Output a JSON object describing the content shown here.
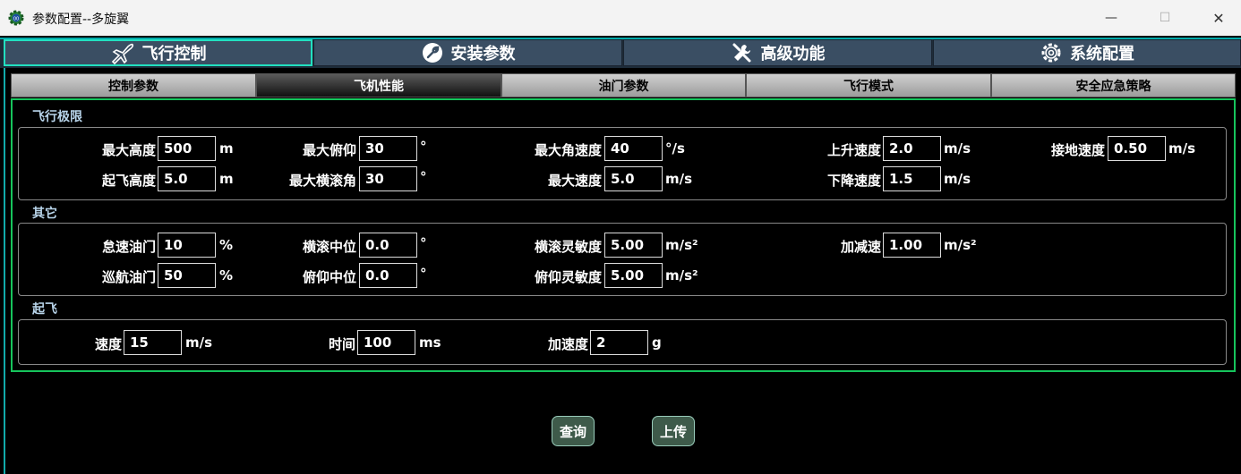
{
  "window": {
    "title": "参数配置--多旋翼",
    "minimize": "—",
    "maximize": "☐",
    "close": "✕"
  },
  "main_tabs": [
    {
      "label": "飞行控制",
      "icon": "airplane-icon",
      "active": true
    },
    {
      "label": "安装参数",
      "icon": "wrench-icon",
      "active": false
    },
    {
      "label": "高级功能",
      "icon": "tools-icon",
      "active": false
    },
    {
      "label": "系统配置",
      "icon": "gear-icon",
      "active": false
    }
  ],
  "sub_tabs": [
    {
      "label": "控制参数",
      "active": false
    },
    {
      "label": "飞机性能",
      "active": true
    },
    {
      "label": "油门参数",
      "active": false
    },
    {
      "label": "飞行模式",
      "active": false
    },
    {
      "label": "安全应急策略",
      "active": false
    }
  ],
  "sections": {
    "flight_limits": {
      "title": "飞行极限",
      "fields": {
        "max_height": {
          "label": "最大高度",
          "value": "500",
          "unit": "m"
        },
        "takeoff_height": {
          "label": "起飞高度",
          "value": "5.0",
          "unit": "m"
        },
        "max_pitch": {
          "label": "最大俯仰",
          "value": "30",
          "unit": "°"
        },
        "max_roll": {
          "label": "最大横滚角",
          "value": "30",
          "unit": "°"
        },
        "max_angular_speed": {
          "label": "最大角速度",
          "value": "40",
          "unit": "°/s"
        },
        "max_speed": {
          "label": "最大速度",
          "value": "5.0",
          "unit": "m/s"
        },
        "climb_speed": {
          "label": "上升速度",
          "value": "2.0",
          "unit": "m/s"
        },
        "descent_speed": {
          "label": "下降速度",
          "value": "1.5",
          "unit": "m/s"
        },
        "landing_speed": {
          "label": "接地速度",
          "value": "0.50",
          "unit": "m/s"
        }
      }
    },
    "other": {
      "title": "其它",
      "fields": {
        "idle_throttle": {
          "label": "怠速油门",
          "value": "10",
          "unit": "%"
        },
        "cruise_throttle": {
          "label": "巡航油门",
          "value": "50",
          "unit": "%"
        },
        "roll_center": {
          "label": "横滚中位",
          "value": "0.0",
          "unit": "°"
        },
        "pitch_center": {
          "label": "俯仰中位",
          "value": "0.0",
          "unit": "°"
        },
        "roll_sensitivity": {
          "label": "横滚灵敏度",
          "value": "5.00",
          "unit": "m/s²"
        },
        "pitch_sensitivity": {
          "label": "俯仰灵敏度",
          "value": "5.00",
          "unit": "m/s²"
        },
        "accel_decel": {
          "label": "加减速",
          "value": "1.00",
          "unit": "m/s²"
        }
      }
    },
    "takeoff": {
      "title": "起飞",
      "fields": {
        "speed": {
          "label": "速度",
          "value": "15",
          "unit": "m/s"
        },
        "time": {
          "label": "时间",
          "value": "100",
          "unit": "ms"
        },
        "acceleration": {
          "label": "加速度",
          "value": "2",
          "unit": "g"
        }
      }
    }
  },
  "actions": {
    "query": "查询",
    "upload": "上传"
  }
}
